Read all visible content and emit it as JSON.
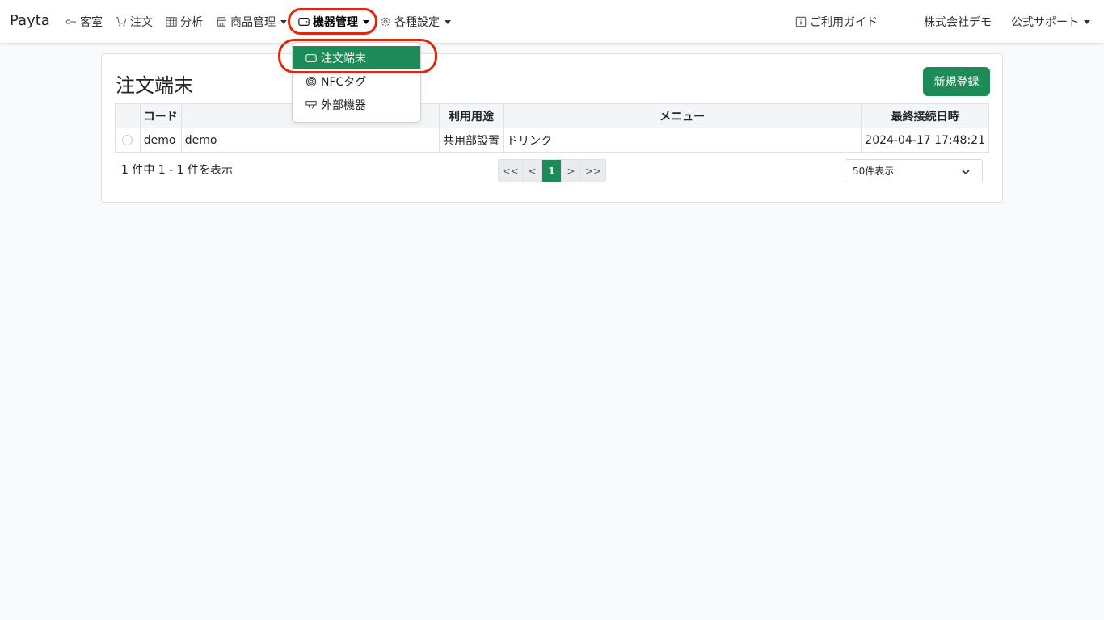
{
  "nav": {
    "brand": "Payta",
    "items": [
      {
        "label": "客室",
        "icon": "key-icon"
      },
      {
        "label": "注文",
        "icon": "cart-icon"
      },
      {
        "label": "分析",
        "icon": "table-icon"
      },
      {
        "label": "商品管理",
        "icon": "shop-icon"
      },
      {
        "label": "機器管理",
        "icon": "device-icon"
      },
      {
        "label": "各種設定",
        "icon": "gear-icon"
      }
    ],
    "guide": "ご利用ガイド",
    "company": "株式会社デモ",
    "support": "公式サポート"
  },
  "dropdown": {
    "items": [
      {
        "label": "注文端末",
        "icon": "device-icon"
      },
      {
        "label": "NFCタグ",
        "icon": "nfc-icon"
      },
      {
        "label": "外部機器",
        "icon": "external-device-icon"
      }
    ]
  },
  "main": {
    "title": "注文端末",
    "new_button": "新規登録",
    "table": {
      "headers": [
        "",
        "コード",
        "",
        "利用用途",
        "メニュー",
        "最終接続日時"
      ],
      "rows": [
        [
          "",
          "demo",
          "demo",
          "共用部設置",
          "ドリンク",
          "2024-04-17 17:48:21"
        ]
      ]
    },
    "count_text": "1 件中 1 - 1 件を表示",
    "pagination": [
      "<<",
      "<",
      "1",
      ">",
      ">>"
    ],
    "per_page": "50件表示"
  },
  "colors": {
    "accent": "#1e8a57",
    "highlight": "#dc2a10"
  }
}
